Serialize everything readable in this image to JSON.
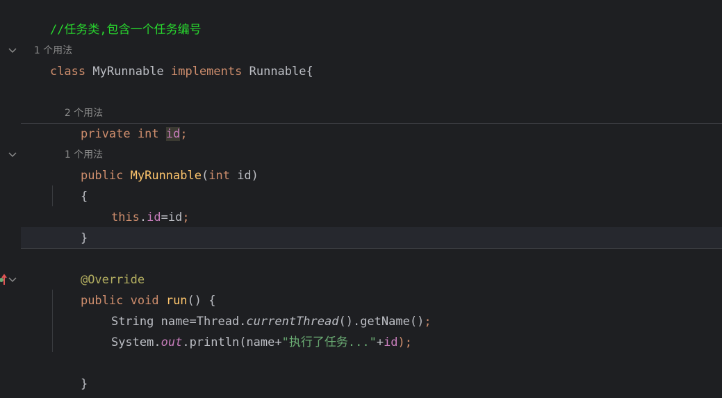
{
  "editor": {
    "comment": "//任务类,包含一个任务编号",
    "usage_hint_1": "1 个用法",
    "class_kw": "class",
    "class_name": "MyRunnable",
    "implements_kw": "implements",
    "interface_name": "Runnable{",
    "usage_hint_2": "2 个用法",
    "private_kw": "private",
    "int_kw": "int",
    "field_id": "id",
    "semicolon": ";",
    "usage_hint_3": "1 个用法",
    "public_kw": "public",
    "ctor_name": "MyRunnable",
    "ctor_params_open": "(",
    "ctor_param_type": "int",
    "ctor_param_name": " id)",
    "brace_open": "{",
    "this_kw": "this",
    "dot": ".",
    "this_field": "id",
    "assign": "=id",
    "brace_close": "}",
    "annotation": "@Override",
    "void_kw": "void",
    "method_name": "run",
    "method_sig": "() {",
    "stmt1_a": "String name=Thread.",
    "stmt1_b": "currentThread",
    "stmt1_c": "().getName()",
    "stmt2_a": "System.",
    "stmt2_b": "out",
    "stmt2_c": ".println(name+",
    "stmt2_str": "\"执行了任务...\"",
    "stmt2_d": "+",
    "stmt2_e": "id",
    "stmt2_f": ");",
    "class_close": "}"
  },
  "icons": {
    "fold_icon": "chevron-down",
    "override_marker": "arrow-up"
  }
}
